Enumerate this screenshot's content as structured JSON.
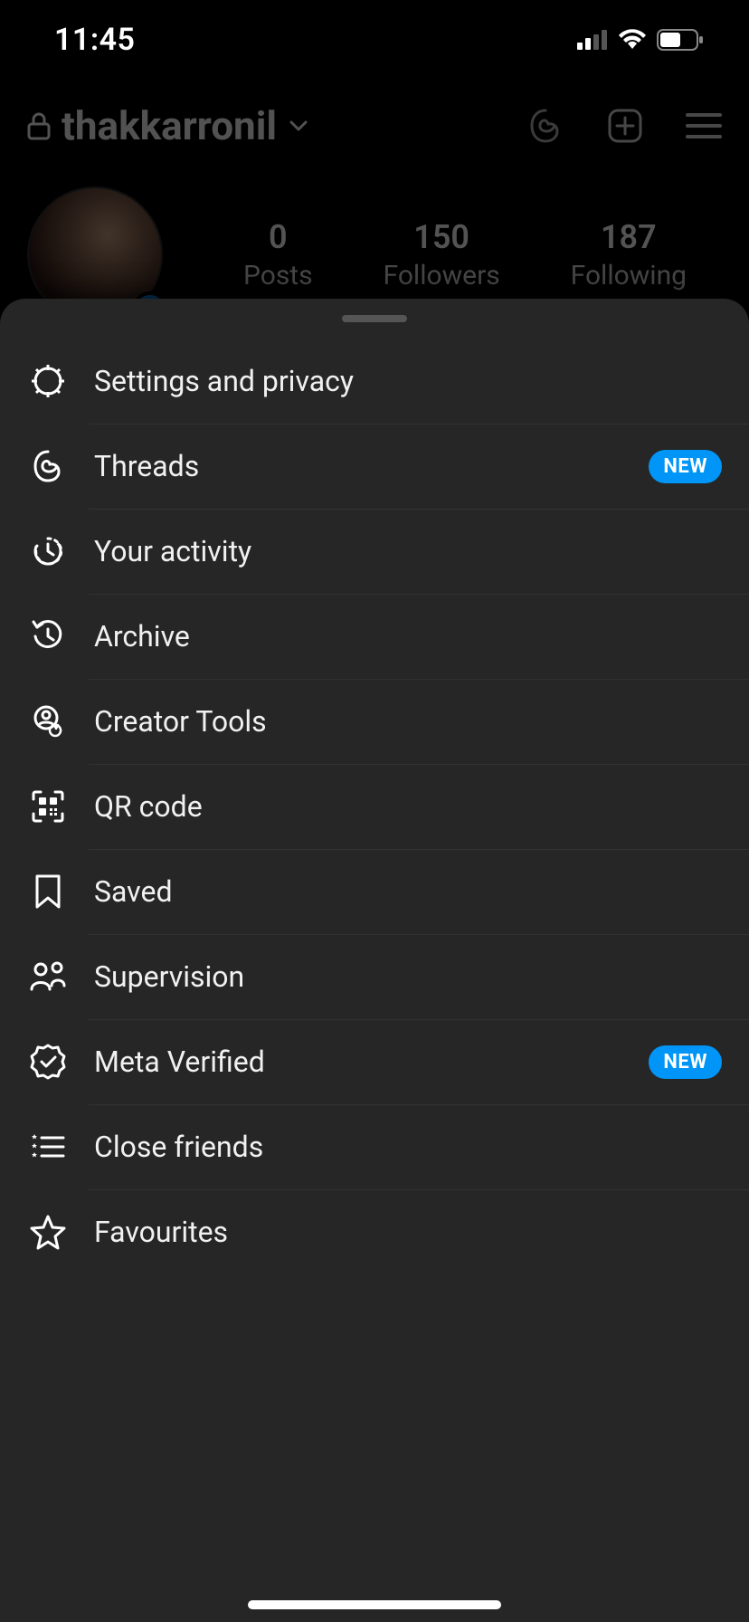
{
  "status": {
    "time": "11:45"
  },
  "profile": {
    "username": "thakkarronil",
    "stats": {
      "posts": {
        "value": "0",
        "label": "Posts"
      },
      "followers": {
        "value": "150",
        "label": "Followers"
      },
      "following": {
        "value": "187",
        "label": "Following"
      }
    }
  },
  "menu": {
    "items": [
      {
        "icon": "gear-icon",
        "label": "Settings and privacy",
        "badge": ""
      },
      {
        "icon": "threads-icon",
        "label": "Threads",
        "badge": "NEW"
      },
      {
        "icon": "activity-icon",
        "label": "Your activity",
        "badge": ""
      },
      {
        "icon": "archive-icon",
        "label": "Archive",
        "badge": ""
      },
      {
        "icon": "creator-tools-icon",
        "label": "Creator Tools",
        "badge": ""
      },
      {
        "icon": "qr-code-icon",
        "label": "QR code",
        "badge": ""
      },
      {
        "icon": "bookmark-icon",
        "label": "Saved",
        "badge": ""
      },
      {
        "icon": "supervision-icon",
        "label": "Supervision",
        "badge": ""
      },
      {
        "icon": "meta-verified-icon",
        "label": "Meta Verified",
        "badge": "NEW"
      },
      {
        "icon": "close-friends-icon",
        "label": "Close friends",
        "badge": ""
      },
      {
        "icon": "star-icon",
        "label": "Favourites",
        "badge": ""
      }
    ]
  }
}
